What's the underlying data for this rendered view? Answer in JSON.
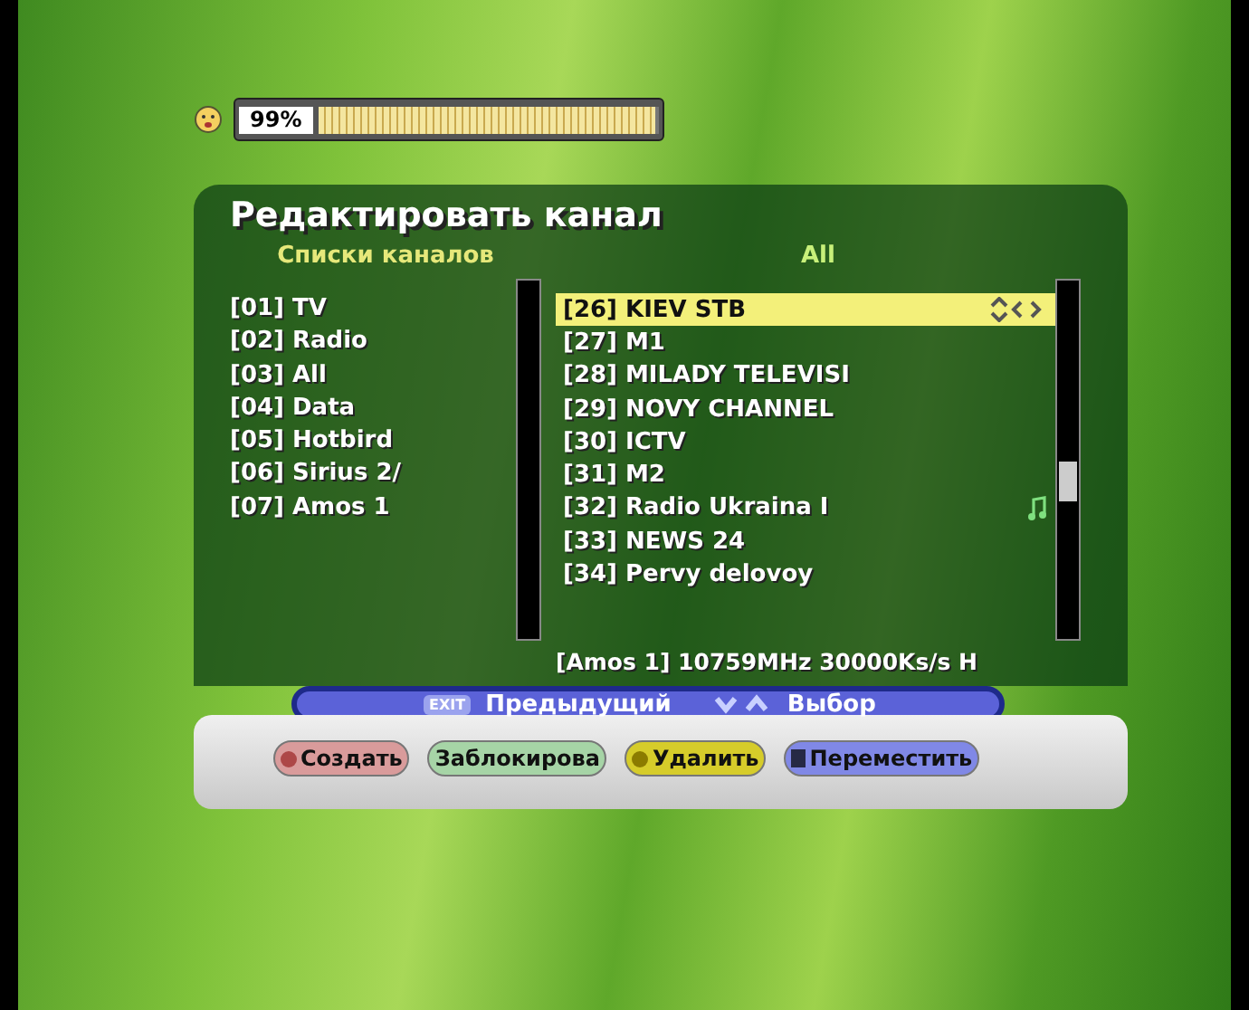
{
  "signal": {
    "reading": "99%",
    "level": 0.99
  },
  "dialog": {
    "title": "Редактировать канал",
    "lists": {
      "header": "Списки каналов",
      "items": [
        {
          "label": "[01] TV"
        },
        {
          "label": "[02] Radio"
        },
        {
          "label": "[03] All"
        },
        {
          "label": "[04] Data"
        },
        {
          "label": "[05] Hotbird"
        },
        {
          "label": "[06] Sirius 2/"
        },
        {
          "label": "[07] Amos 1"
        }
      ]
    },
    "channels": {
      "header": "All",
      "items": [
        {
          "label": "[26] KIEV STB",
          "selected": true,
          "kind": "tv"
        },
        {
          "label": "[27] M1",
          "selected": false,
          "kind": "tv"
        },
        {
          "label": "[28] MILADY TELEVISI",
          "selected": false,
          "kind": "tv"
        },
        {
          "label": "[29] NOVY CHANNEL",
          "selected": false,
          "kind": "tv"
        },
        {
          "label": "[30] ICTV",
          "selected": false,
          "kind": "tv"
        },
        {
          "label": "[31] M2",
          "selected": false,
          "kind": "tv"
        },
        {
          "label": "[32] Radio Ukraina I",
          "selected": false,
          "kind": "radio"
        },
        {
          "label": "[33] NEWS 24",
          "selected": false,
          "kind": "tv"
        },
        {
          "label": "[34] Pervy delovoy",
          "selected": false,
          "kind": "tv"
        }
      ]
    },
    "info": "[Amos 1] 10759MHz 30000Ks/s H"
  },
  "help": [
    {
      "kind": "key",
      "key": "EXIT",
      "label": "Предыдущий"
    },
    {
      "kind": "arrows",
      "label": "Выбор"
    }
  ],
  "buttons": [
    {
      "label": "Создать",
      "color": "#d99b9b",
      "kind": "dot"
    },
    {
      "label": "Заблокирова",
      "color": "#a6d4a6",
      "kind": "plain"
    },
    {
      "label": "Удалить",
      "color": "#d6cc2a",
      "kind": "dot"
    },
    {
      "label": "Переместить",
      "color": "#8088e6",
      "kind": "square"
    }
  ]
}
